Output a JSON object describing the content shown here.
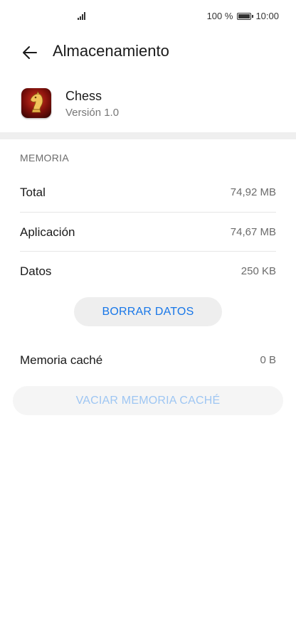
{
  "status_bar": {
    "battery_percent": "100 %",
    "time": "10:00",
    "icons": [
      "signal-icon",
      "battery-icon"
    ]
  },
  "app_bar": {
    "title": "Almacenamiento",
    "back_icon": "arrow-left-icon"
  },
  "app": {
    "name": "Chess",
    "version": "Versión 1.0",
    "icon": "chess-knight-app-icon"
  },
  "memory": {
    "section_label": "MEMORIA",
    "rows": [
      {
        "label": "Total",
        "value": "74,92 MB"
      },
      {
        "label": "Aplicación",
        "value": "74,67 MB"
      },
      {
        "label": "Datos",
        "value": "250 KB"
      }
    ],
    "clear_data_label": "BORRAR DATOS"
  },
  "cache": {
    "label": "Memoria caché",
    "value": "0 B",
    "clear_cache_label": "VACIAR MEMORIA CACHÉ"
  },
  "colors": {
    "accent": "#1877e8",
    "accent_disabled": "#9ec6f3",
    "divider_band": "#efefef"
  }
}
